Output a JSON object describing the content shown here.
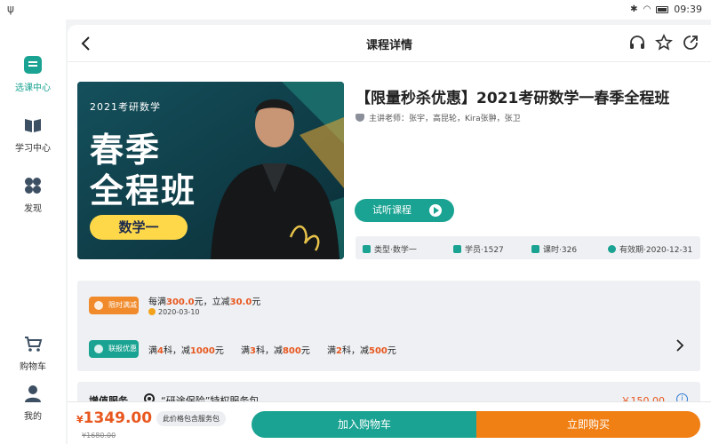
{
  "status_bar": {
    "time": "09:39"
  },
  "sidebar": {
    "items": [
      {
        "label": "选课中心",
        "icon": "course-select-icon",
        "active": true
      },
      {
        "label": "学习中心",
        "icon": "open-book-icon",
        "active": false
      },
      {
        "label": "发现",
        "icon": "discover-icon",
        "active": false
      },
      {
        "label": "购物车",
        "icon": "cart-icon",
        "active": false
      },
      {
        "label": "我的",
        "icon": "user-icon",
        "active": false
      }
    ]
  },
  "header": {
    "title": "课程详情",
    "icons": [
      "back-icon",
      "headset-icon",
      "star-icon",
      "share-icon"
    ]
  },
  "course": {
    "banner": {
      "year_text": "2021考研数学",
      "big_line1": "春季",
      "big_line2": "全程班",
      "tag": "数学一"
    },
    "title": "【限量秒杀优惠】2021考研数学一春季全程班",
    "teachers": "主讲老师：张宇，高昆轮，Kira张翀，张卫",
    "trial_button": "试听课程",
    "info": {
      "type": "类型·数学一",
      "students": "学员·1527",
      "lessons": "课时·326",
      "valid": "有效期·2020-12-31"
    }
  },
  "promotions": {
    "limited": {
      "badge": "限时满减",
      "prefix": "每满",
      "amount1": "300.0",
      "mid": "元，立减",
      "amount2": "30.0",
      "suffix": "元",
      "date": "2020-03-10"
    },
    "combo": {
      "badge": "联报优惠",
      "items": [
        {
          "a": "满",
          "n": "4",
          "b": "科，减",
          "v": "1000",
          "c": "元"
        },
        {
          "a": "满",
          "n": "3",
          "b": "科，减",
          "v": "800",
          "c": "元"
        },
        {
          "a": "满",
          "n": "2",
          "b": "科，减",
          "v": "500",
          "c": "元"
        }
      ]
    }
  },
  "value_service": {
    "label": "增值服务",
    "option": "“研途保险”特权服务包",
    "price": "￥150.00"
  },
  "bottom_bar": {
    "currency": "¥",
    "price": "1349.00",
    "original": "¥1680.00",
    "package_note": "此价格包含服务包",
    "cart_button": "加入购物车",
    "buy_button": "立即购买"
  },
  "colors": {
    "accent_green": "#1aa392",
    "accent_orange": "#f07f14",
    "price_red": "#e8571e"
  }
}
